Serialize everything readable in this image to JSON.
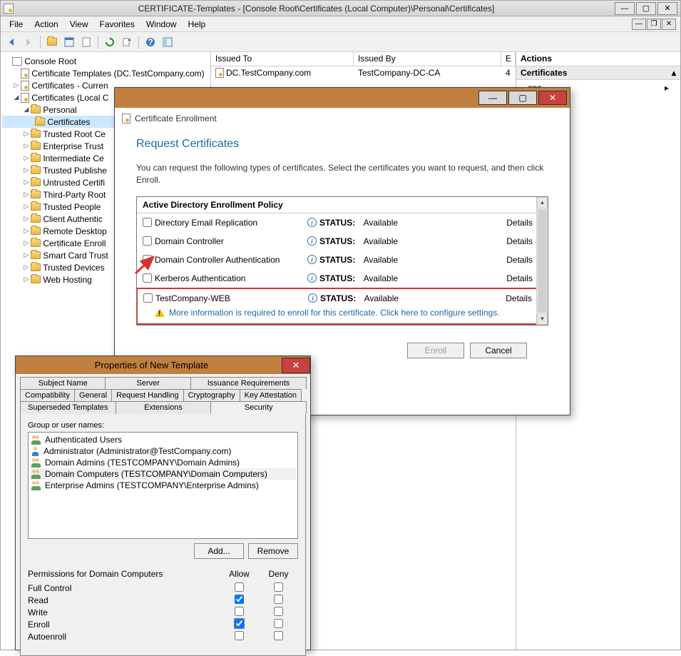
{
  "main_window": {
    "title": "CERTIFICATE-Templates - [Console Root\\Certificates (Local Computer)\\Personal\\Certificates]"
  },
  "menubar": {
    "file": "File",
    "action": "Action",
    "view": "View",
    "favorites": "Favorites",
    "window": "Window",
    "help": "Help"
  },
  "tree": {
    "root": "Console Root",
    "cert_templates": "Certificate Templates (DC.TestCompany.com)",
    "certs_current": "Certificates - Curren",
    "certs_local": "Certificates (Local C",
    "personal": "Personal",
    "certificates": "Certificates",
    "trusted_root": "Trusted Root Ce",
    "enterprise_trust": "Enterprise Trust",
    "intermediate": "Intermediate Ce",
    "trusted_pub": "Trusted Publishe",
    "untrusted": "Untrusted Certifi",
    "third_party": "Third-Party Root",
    "trusted_people": "Trusted People",
    "client_auth": "Client Authentic",
    "remote_desktop": "Remote Desktop",
    "cert_enroll": "Certificate Enroll",
    "smart_card": "Smart Card Trust",
    "trusted_devices": "Trusted Devices",
    "web_hosting": "Web Hosting"
  },
  "list": {
    "col_issued_to": "Issued To",
    "col_issued_by": "Issued By",
    "col_e": "E",
    "row1_to": "DC.TestCompany.com",
    "row1_by": "TestCompany-DC-CA",
    "row1_e": "4"
  },
  "actions": {
    "header": "Actions",
    "sub": "Certificates",
    "more": "ons"
  },
  "enroll": {
    "window_title": "Certificate Enrollment",
    "heading": "Request Certificates",
    "desc": "You can request the following types of certificates. Select the certificates you want to request, and then click Enroll.",
    "policy_header": "Active Directory Enrollment Policy",
    "status_label": "STATUS:",
    "status_available": "Available",
    "details": "Details",
    "certs": {
      "c1": "Directory Email Replication",
      "c2": "Domain Controller",
      "c3": "Domain Controller Authentication",
      "c4": "Kerberos Authentication",
      "c5": "TestCompany-WEB"
    },
    "more_info": "More information is required to enroll for this certificate. Click here to configure settings.",
    "btn_enroll": "Enroll",
    "btn_cancel": "Cancel"
  },
  "props": {
    "title": "Properties of New Template",
    "tabs": {
      "subject_name": "Subject Name",
      "server": "Server",
      "issuance": "Issuance Requirements",
      "compatibility": "Compatibility",
      "general": "General",
      "request": "Request Handling",
      "crypto": "Cryptography",
      "key_att": "Key Attestation",
      "superseded": "Superseded Templates",
      "extensions": "Extensions",
      "security": "Security"
    },
    "group_label": "Group or user names:",
    "users": {
      "u1": "Authenticated Users",
      "u2": "Administrator (Administrator@TestCompany.com)",
      "u3": "Domain Admins (TESTCOMPANY\\Domain Admins)",
      "u4": "Domain Computers (TESTCOMPANY\\Domain Computers)",
      "u5": "Enterprise Admins (TESTCOMPANY\\Enterprise Admins)"
    },
    "btn_add": "Add...",
    "btn_remove": "Remove",
    "perm_header": "Permissions for Domain Computers",
    "col_allow": "Allow",
    "col_deny": "Deny",
    "perms": {
      "p1": "Full Control",
      "p2": "Read",
      "p3": "Write",
      "p4": "Enroll",
      "p5": "Autoenroll"
    }
  }
}
